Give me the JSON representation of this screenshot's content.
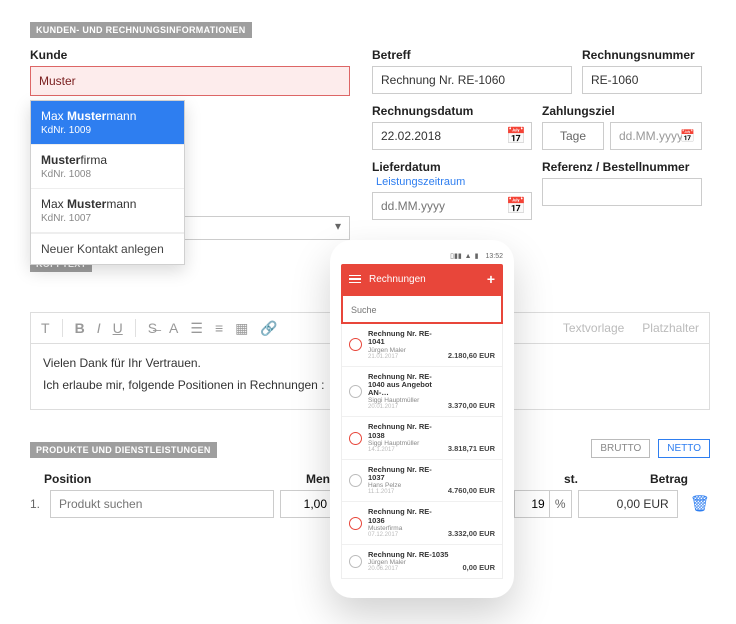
{
  "section_customer_header": "KUNDEN- UND RECHNUNGSINFORMATIONEN",
  "kunde_label": "Kunde",
  "kunde_value": "Muster",
  "autocomplete": {
    "items": [
      {
        "name_prefix": "Max ",
        "name_bold": "Muster",
        "name_suffix": "mann",
        "sub": "KdNr. 1009",
        "active": true
      },
      {
        "name_prefix": "",
        "name_bold": "Muster",
        "name_suffix": "firma",
        "sub": "KdNr. 1008",
        "active": false
      },
      {
        "name_prefix": "Max ",
        "name_bold": "Muster",
        "name_suffix": "mann",
        "sub": "KdNr. 1007",
        "active": false
      }
    ],
    "footer": "Neuer Kontakt anlegen"
  },
  "betreff_label": "Betreff",
  "betreff_value": "Rechnung Nr. RE-1060",
  "rechnungsnummer_label": "Rechnungsnummer",
  "rechnungsnummer_value": "RE-1060",
  "rechnungsdatum_label": "Rechnungsdatum",
  "rechnungsdatum_value": "22.02.2018",
  "zahlungsziel_label": "Zahlungsziel",
  "zahlungsziel_tage": "Tage",
  "zahlungsziel_placeholder": "dd.MM.yyyy",
  "lieferdatum_label": "Lieferdatum",
  "lieferdatum_link": "Leistungszeitraum",
  "lieferdatum_placeholder": "dd.MM.yyyy",
  "referenz_label": "Referenz / Bestellnummer",
  "kopftext_header": "KOPFTEXT",
  "toolbar": {
    "t": "T",
    "b": "B",
    "i": "I",
    "u": "U",
    "textvorlage": "Textvorlage",
    "platzhalter": "Platzhalter"
  },
  "editor_line1": "Vielen Dank für Ihr Vertrauen.",
  "editor_line2": "Ich erlaube mir, folgende Positionen in Rechnungen :",
  "products_header": "PRODUKTE UND DIENSTLEISTUNGEN",
  "brutto": "BRUTTO",
  "netto": "NETTO",
  "th_position": "Position",
  "th_menge": "Menge",
  "th_st": "st.",
  "th_betrag": "Betrag",
  "row_idx": "1.",
  "prod_placeholder": "Produkt suchen",
  "menge_val": "1,00",
  "st_val": "19",
  "st_pct": "%",
  "betrag_val": "0,00 EUR",
  "phone": {
    "time": "13:52",
    "title": "Rechnungen",
    "search_placeholder": "Suche",
    "items": [
      {
        "title": "Rechnung Nr. RE-1041",
        "name": "Jürgen Maler",
        "date": "21.01.2017",
        "amt": "2.180,60 EUR",
        "gray": false
      },
      {
        "title": "Rechnung Nr. RE-1040 aus Angebot AN-…",
        "name": "Siggi Hauptmüller",
        "date": "20.01.2017",
        "amt": "3.370,00 EUR",
        "gray": true
      },
      {
        "title": "Rechnung Nr. RE-1038",
        "name": "Siggi Hauptmüller",
        "date": "14.1.2017",
        "amt": "3.818,71 EUR",
        "gray": false
      },
      {
        "title": "Rechnung Nr. RE-1037",
        "name": "Hans Pelze",
        "date": "11.1.2017",
        "amt": "4.760,00 EUR",
        "gray": true
      },
      {
        "title": "Rechnung Nr. RE-1036",
        "name": "Musterfirma",
        "date": "07.12.2017",
        "amt": "3.332,00 EUR",
        "gray": false
      },
      {
        "title": "Rechnung Nr. RE-1035",
        "name": "Jürgen Maler",
        "date": "20.06.2017",
        "amt": "0,00 EUR",
        "gray": true
      }
    ]
  }
}
